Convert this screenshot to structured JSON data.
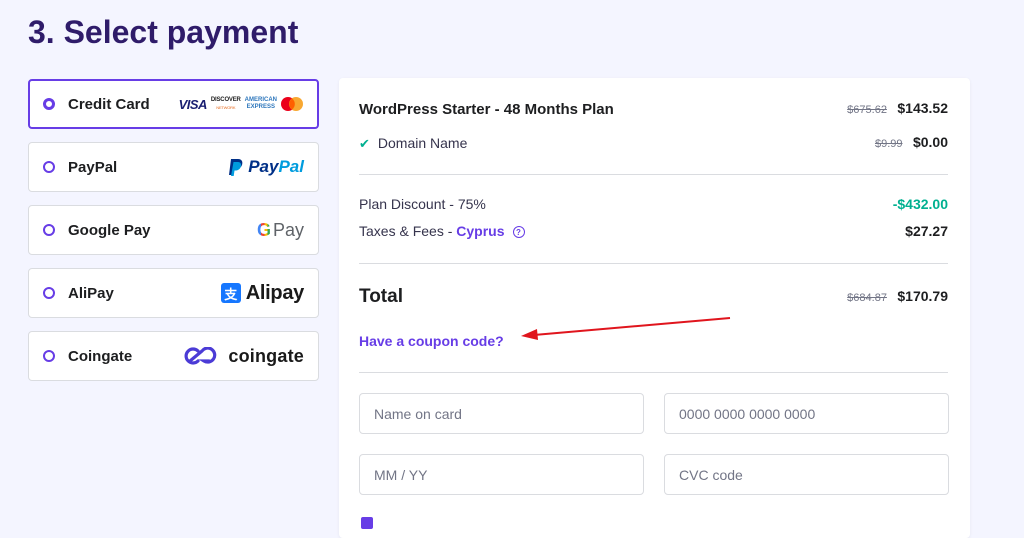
{
  "heading": "3. Select payment",
  "methods": [
    {
      "label": "Credit Card",
      "selected": true
    },
    {
      "label": "PayPal",
      "selected": false
    },
    {
      "label": "Google Pay",
      "selected": false
    },
    {
      "label": "AliPay",
      "selected": false
    },
    {
      "label": "Coingate",
      "selected": false
    }
  ],
  "logos": {
    "visa": "VISA",
    "discover": "DISCOVER",
    "discover_sub": "NETWORK",
    "amex_line1": "AMERICAN",
    "amex_line2": "EXPRESS",
    "paypal_pay": "Pay",
    "paypal_pal": "Pal",
    "gpay_g": "G",
    "gpay_pay": "Pay",
    "alipay": "Alipay",
    "alipay_mark": "支",
    "coingate": "coingate"
  },
  "summary": {
    "plan_name": "WordPress Starter - 48 Months Plan",
    "plan_old_price": "$675.62",
    "plan_price": "$143.52",
    "domain_label": "Domain Name",
    "domain_old_price": "$9.99",
    "domain_price": "$0.00",
    "discount_label": "Plan Discount - 75%",
    "discount_value": "-$432.00",
    "taxes_label": "Taxes & Fees - ",
    "taxes_country": "Cyprus",
    "taxes_value": "$27.27",
    "total_label": "Total",
    "total_old_price": "$684.87",
    "total_price": "$170.79",
    "coupon_link": "Have a coupon code?"
  },
  "form": {
    "name_placeholder": "Name on card",
    "number_placeholder": "0000 0000 0000 0000",
    "expiry_placeholder": "MM / YY",
    "cvc_placeholder": "CVC code"
  },
  "colors": {
    "accent": "#673de6",
    "heading": "#2f1c6a",
    "success": "#00b090",
    "annotation_arrow": "#e0151d"
  }
}
